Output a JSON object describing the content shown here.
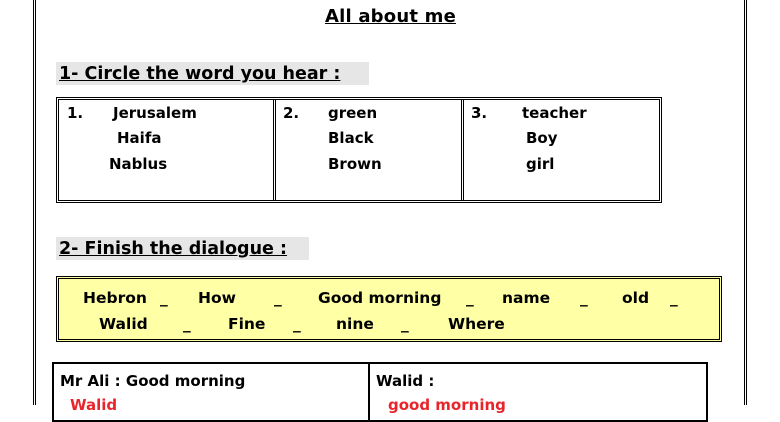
{
  "title": "All about me",
  "q1": {
    "heading": "1- Circle the word you hear :",
    "columns": [
      {
        "number": "1.",
        "words": [
          "Jerusalem",
          "Haifa",
          "Nablus"
        ]
      },
      {
        "number": "2.",
        "words": [
          "green",
          "Black",
          "Brown"
        ]
      },
      {
        "number": "3.",
        "words": [
          "teacher",
          "Boy",
          "girl"
        ]
      }
    ]
  },
  "q2": {
    "heading": "2- Finish the dialogue :",
    "word_bank": {
      "row1": [
        "Hebron",
        "_",
        "How",
        "_",
        "Good morning",
        "_",
        "name",
        "_",
        "old",
        "_"
      ],
      "row2": [
        "Walid",
        "_",
        "Fine",
        "_",
        "nine",
        "_",
        "Where"
      ]
    },
    "bank_color": "#ffffa6",
    "dialogue": {
      "left_speaker": "Mr Ali : Good morning",
      "left_answer": "Walid",
      "right_speaker": "Walid :",
      "right_answer": "good morning",
      "answer_color": "#e8252b"
    }
  }
}
